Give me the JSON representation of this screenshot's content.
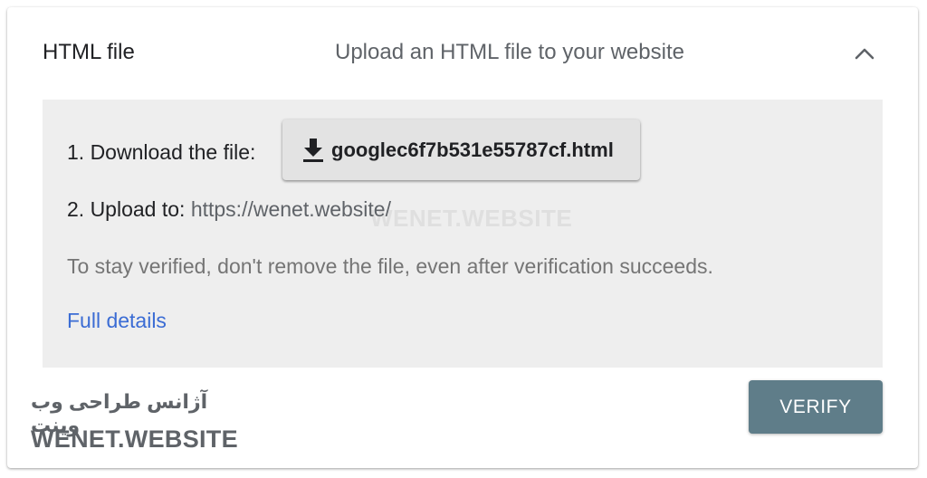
{
  "header": {
    "title": "HTML file",
    "subtitle": "Upload an HTML file to your website",
    "toggle_icon": "chevron-up-icon"
  },
  "steps": {
    "download_label": "1. Download the file:",
    "download_file": "googlec6f7b531e55787cf.html",
    "download_icon": "download-icon",
    "upload_label": "2. Upload to:",
    "upload_url": "https://wenet.website/"
  },
  "note": "To stay verified, don't remove the file, even after verification succeeds.",
  "details_link": "Full details",
  "watermark": "WENET.WEBSITE",
  "branding": {
    "name_fa": "آژانس طراحی وب وینت",
    "name_en": "WENET.WEBSITE"
  },
  "verify_label": "VERIFY",
  "colors": {
    "panel_bg": "#eeeeee",
    "link": "#3b6cd4",
    "verify_button": "#5f7d89",
    "download_button": "#e3e3e3"
  }
}
